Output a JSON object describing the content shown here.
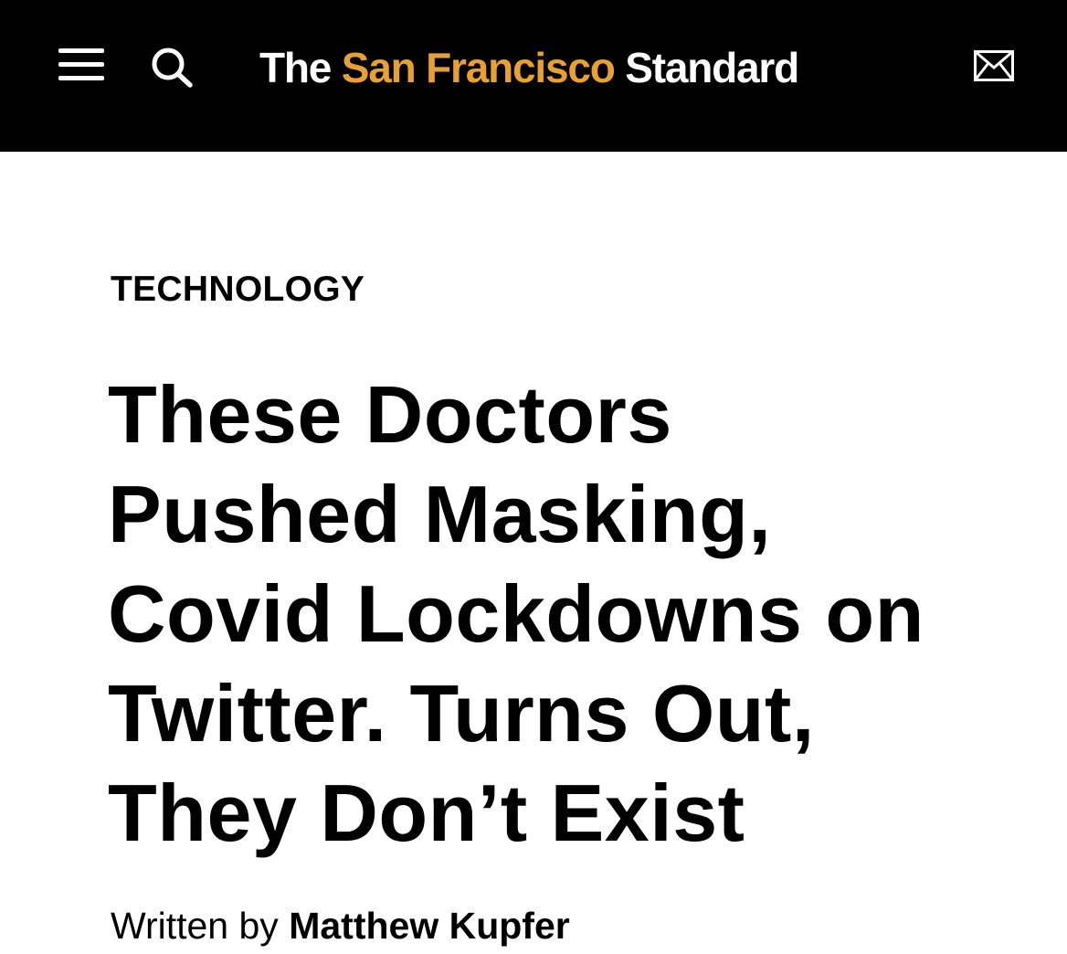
{
  "header": {
    "logo": {
      "part1": "The",
      "part2": "San Francisco",
      "part3": "Standard"
    },
    "icons": {
      "menu": "hamburger-menu-icon",
      "search": "search-icon",
      "newsletter": "envelope-icon"
    },
    "colors": {
      "background": "#000000",
      "accent": "#e9a033",
      "text": "#ffffff"
    }
  },
  "article": {
    "category": "TECHNOLOGY",
    "headline_lines": [
      "These Doctors",
      "Pushed Masking,",
      "Covid Lockdowns on",
      "Twitter. Turns Out,",
      "They Don’t Exist"
    ],
    "byline": {
      "prefix": "Written by",
      "author": "Matthew Kupfer"
    }
  }
}
